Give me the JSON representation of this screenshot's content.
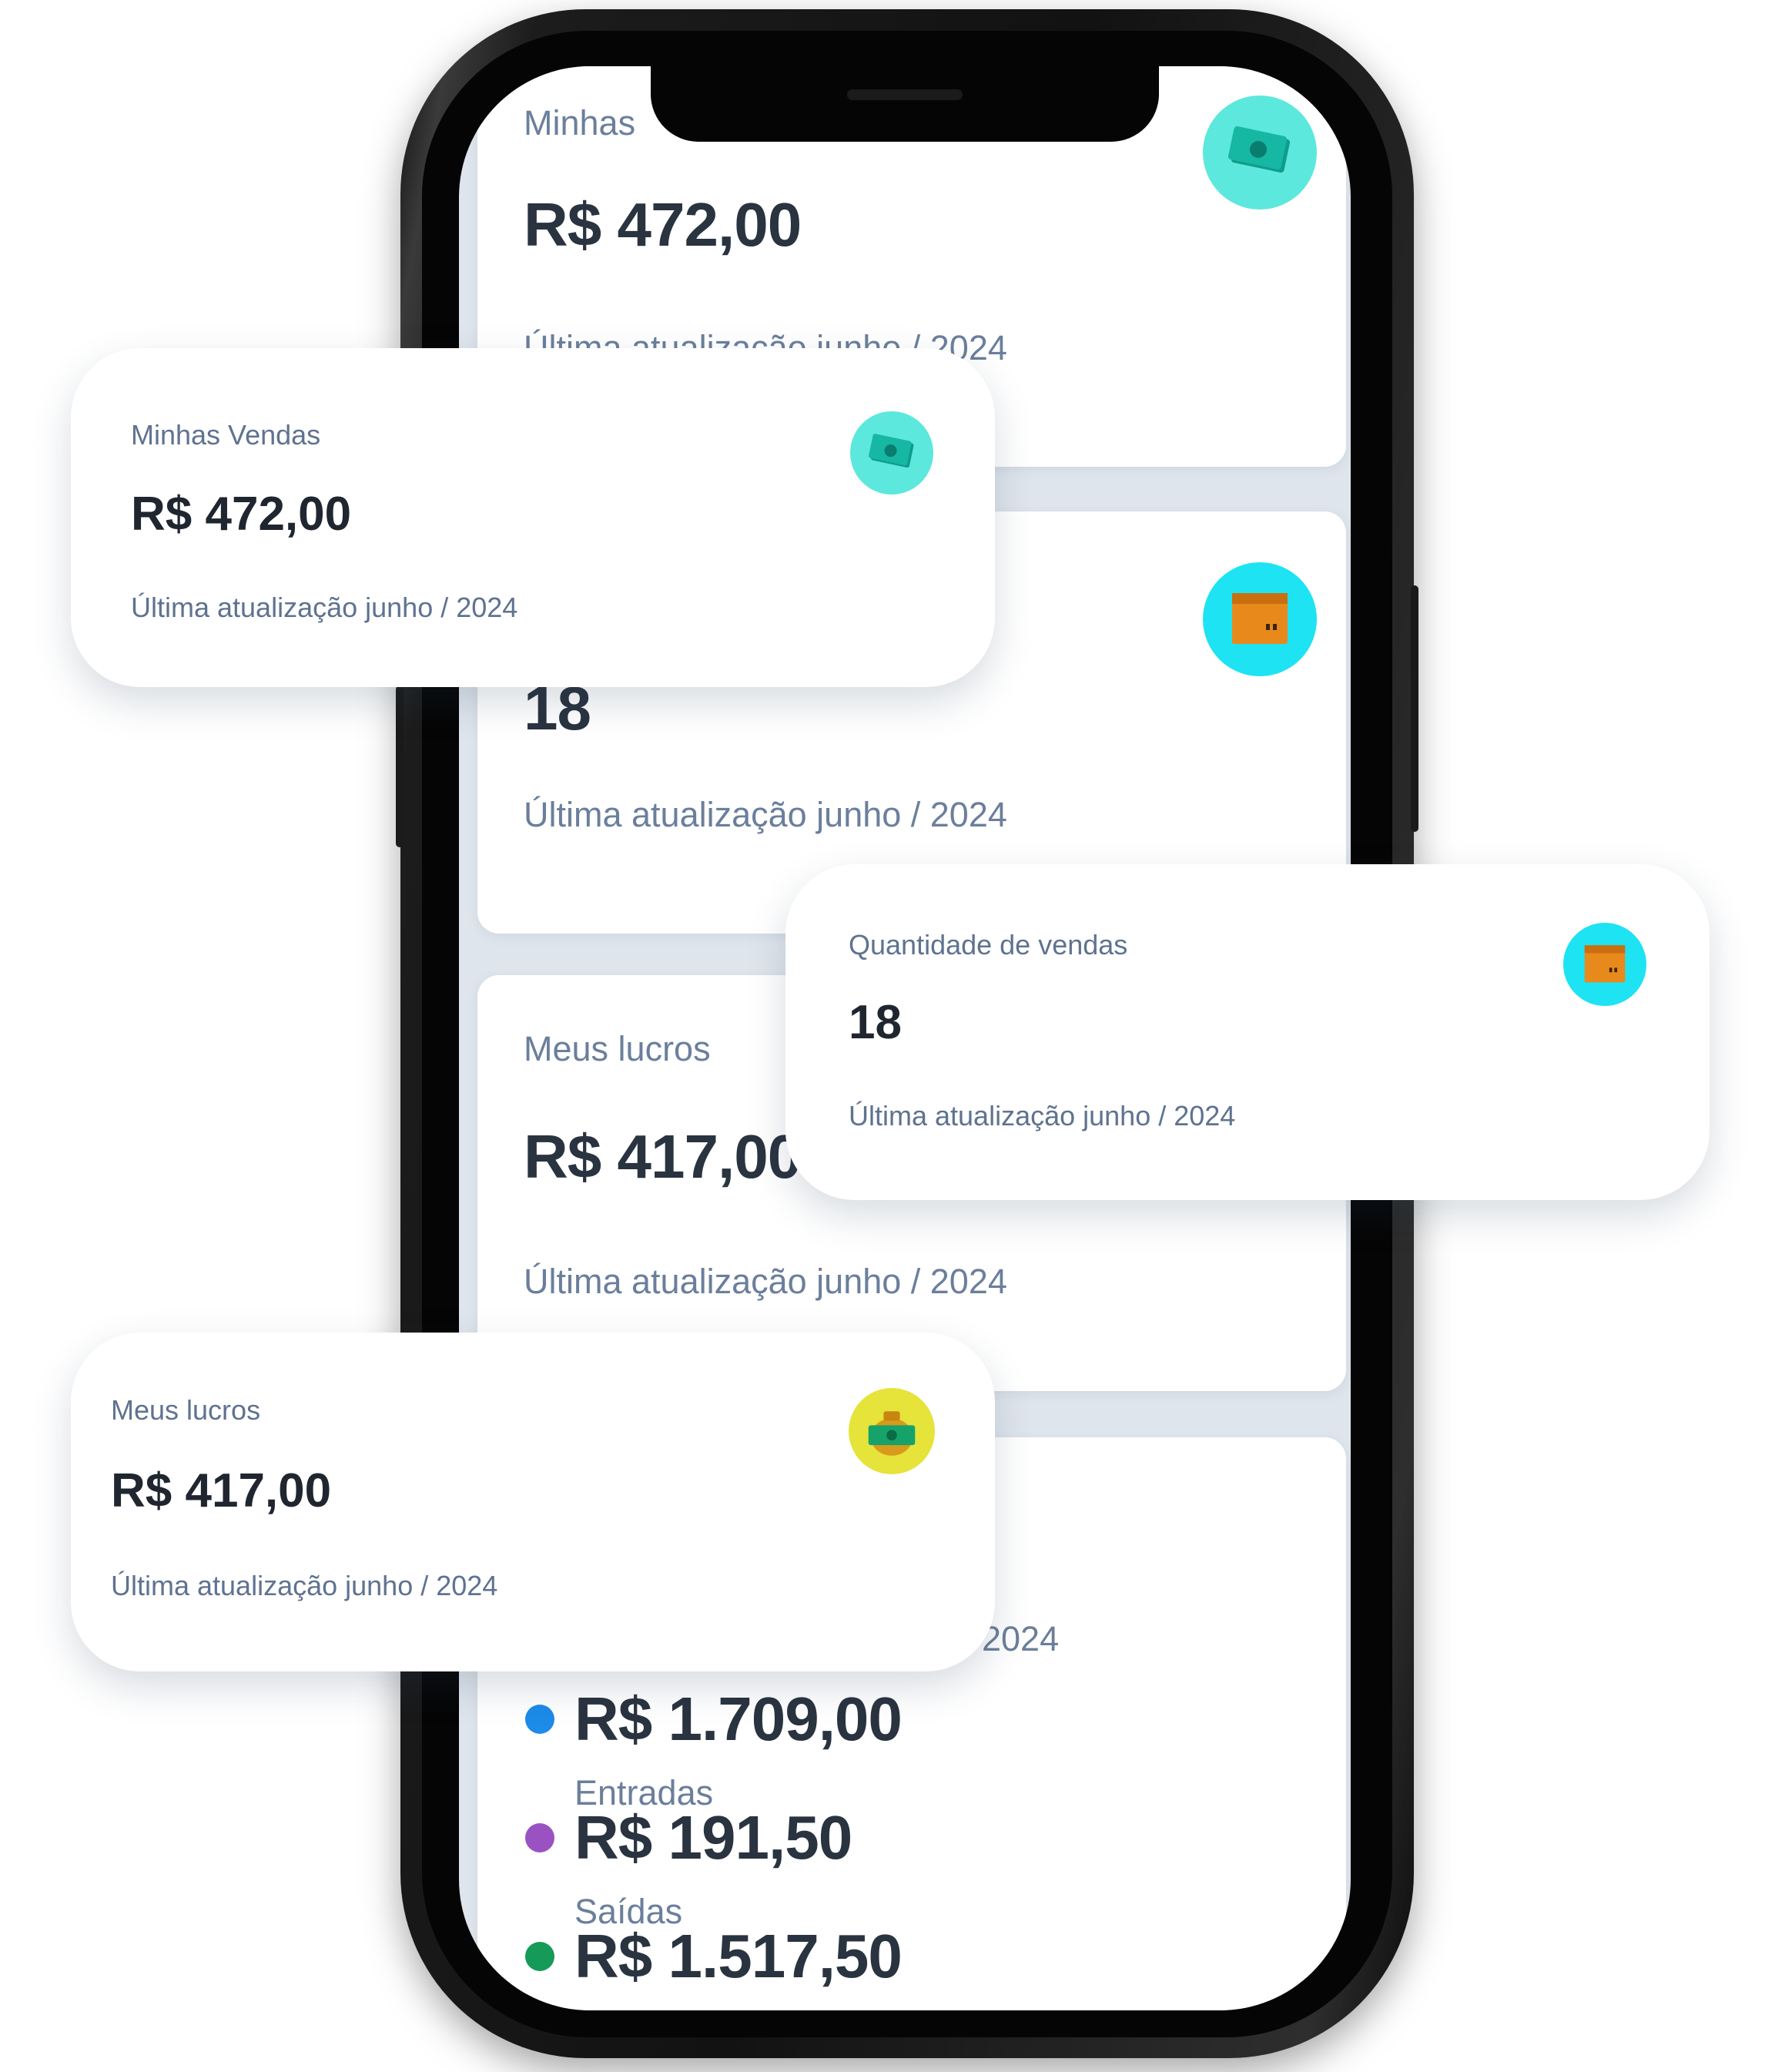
{
  "colors": {
    "teal_icon_bg": "#5ce8dc",
    "cyan_icon_bg": "#1de3f2",
    "yellow_icon_bg": "#e6e33a",
    "dot_entradas": "#1d8be8",
    "dot_saidas": "#9a52c3",
    "dot_saldo": "#159a58",
    "label_text": "#6b7f9c",
    "value_text": "#2a3340"
  },
  "phone_screen": {
    "card_vendas": {
      "label": "Minhas",
      "value": "R$ 472,00",
      "footer": "Última atualização junho / 2024",
      "icon": "cash-icon"
    },
    "card_quantidade": {
      "value": "18",
      "footer": "Última atualização junho / 2024",
      "icon": "box-icon"
    },
    "card_lucros": {
      "label": "Meus lucros",
      "value": "R$ 417,00",
      "footer": "Última atualização junho / 2024"
    },
    "card_resumo": {
      "footer_fragment": "2024",
      "rows": [
        {
          "value": "R$ 1.709,00",
          "caption": "Entradas"
        },
        {
          "value": "R$ 191,50",
          "caption": "Saídas"
        },
        {
          "value": "R$ 1.517,50"
        }
      ]
    }
  },
  "floating_cards": {
    "vendas": {
      "label": "Minhas Vendas",
      "value": "R$ 472,00",
      "footer": "Última atualização junho / 2024",
      "icon": "cash-icon"
    },
    "quantidade": {
      "label": "Quantidade de vendas",
      "value": "18",
      "footer": "Última atualização junho / 2024",
      "icon": "box-icon"
    },
    "lucros": {
      "label": "Meus lucros",
      "value": "R$ 417,00",
      "footer": "Última atualização junho / 2024",
      "icon": "money-bag-icon"
    }
  }
}
